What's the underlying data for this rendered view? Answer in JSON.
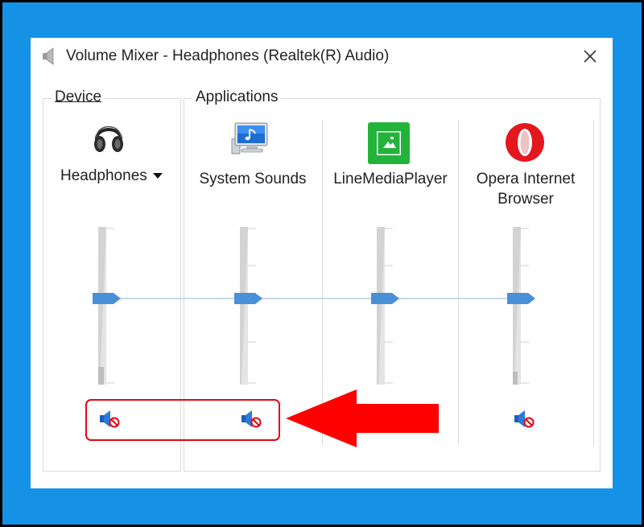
{
  "window": {
    "title": "Volume Mixer - Headphones (Realtek(R) Audio)",
    "title_icon": "speaker-icon",
    "close_icon": "close-icon"
  },
  "device_group": {
    "label": "Device",
    "device_name": "Headphones",
    "icon": "headphones-icon",
    "volume_level": 0.5,
    "muted": true
  },
  "applications_group": {
    "label": "Applications",
    "apps": [
      {
        "name": "System Sounds",
        "icon": "system-sounds-icon",
        "volume_level": 0.5,
        "muted": true
      },
      {
        "name": "LineMediaPlayer",
        "icon": "linemediaplayer-icon",
        "volume_level": 0.5,
        "muted": false
      },
      {
        "name": "Opera Internet Browser",
        "icon": "opera-icon",
        "volume_level": 0.5,
        "muted": true
      }
    ]
  },
  "annotation": {
    "highlight_color": "#e30613",
    "arrow_color": "#ff0000"
  },
  "colors": {
    "frame_blue": "#1592e6",
    "thumb_blue": "#4a90d9"
  }
}
